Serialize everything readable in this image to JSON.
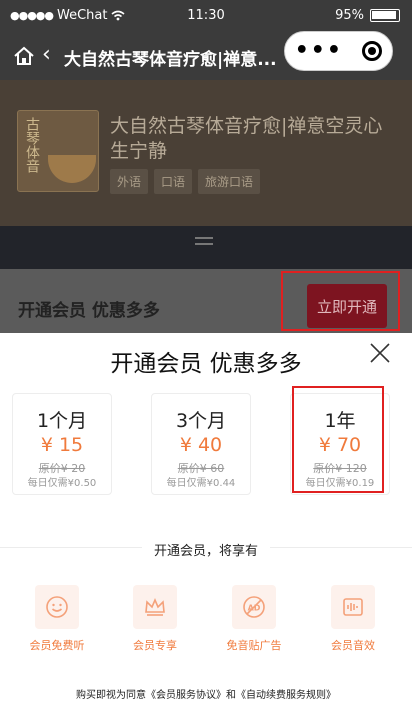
{
  "status_bar": {
    "carrier": "WeChat",
    "time": "11:30",
    "battery": "95%"
  },
  "nav": {
    "title": "大自然古琴体音疗愈|禅意..."
  },
  "album": {
    "cover_text": "古琴体音",
    "title": "大自然古琴体音疗愈|禅意空灵心生宁静",
    "tags": [
      "外语",
      "口语",
      "旅游口语"
    ]
  },
  "promo": {
    "title": "开通会员 优惠多多",
    "button_label": "立即开通"
  },
  "sheet": {
    "title": "开通会员 优惠多多",
    "plans": [
      {
        "name": "1个月",
        "price": "¥ 15",
        "original": "原价¥ 20",
        "daily": "每日仅需¥0.50"
      },
      {
        "name": "3个月",
        "price": "¥ 40",
        "original": "原价¥ 60",
        "daily": "每日仅需¥0.44"
      },
      {
        "name": "1年",
        "price": "¥ 70",
        "original": "原价¥ 120",
        "daily": "每日仅需¥0.19"
      }
    ],
    "benefits_heading": "开通会员，将享有",
    "benefits": [
      {
        "label": "会员免费听",
        "icon": "smile-icon"
      },
      {
        "label": "会员专享",
        "icon": "crown-icon"
      },
      {
        "label": "免音贴广告",
        "icon": "no-ad-icon"
      },
      {
        "label": "会员音效",
        "icon": "soundwave-icon"
      }
    ],
    "agreement": "购买即视为同意《会员服务协议》和《自动续费服务规则》"
  },
  "colors": {
    "accent": "#f07a3c",
    "highlight": "#e02020",
    "promo_button": "#7d1420"
  }
}
